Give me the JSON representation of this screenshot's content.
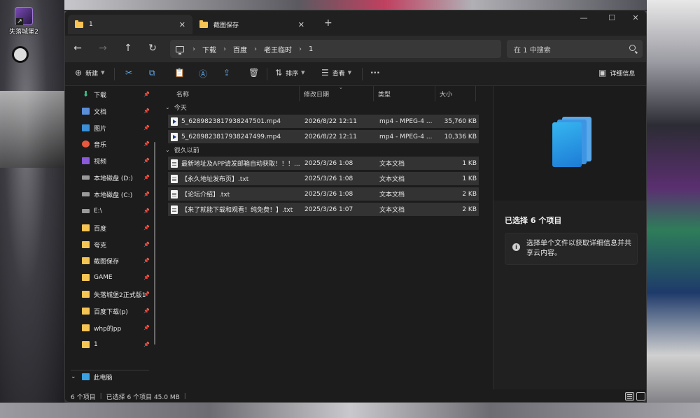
{
  "desktop": {
    "icon_label": "失落城堡2"
  },
  "tabs": [
    {
      "label": "1"
    },
    {
      "label": "截图保存"
    }
  ],
  "address": {
    "crumbs": [
      "下载",
      "百度",
      "老王临时",
      "1"
    ]
  },
  "search": {
    "placeholder": "在 1 中搜索"
  },
  "toolbar": {
    "new_label": "新建",
    "sort_label": "排序",
    "view_label": "查看",
    "details_label": "详细信息"
  },
  "sidebar": {
    "items": [
      {
        "label": "下载",
        "icon": "download-icon"
      },
      {
        "label": "文档",
        "icon": "document-icon"
      },
      {
        "label": "图片",
        "icon": "pictures-icon"
      },
      {
        "label": "音乐",
        "icon": "music-icon"
      },
      {
        "label": "视频",
        "icon": "video-icon"
      },
      {
        "label": "本地磁盘 (D:)",
        "icon": "drive-icon"
      },
      {
        "label": "本地磁盘 (C:)",
        "icon": "drive-icon"
      },
      {
        "label": "E:\\",
        "icon": "drive-icon"
      },
      {
        "label": "百度",
        "icon": "folder-icon"
      },
      {
        "label": "夸克",
        "icon": "folder-icon"
      },
      {
        "label": "截图保存",
        "icon": "folder-icon"
      },
      {
        "label": "GAME",
        "icon": "folder-icon"
      },
      {
        "label": "失落城堡2正式版1",
        "icon": "folder-icon"
      },
      {
        "label": "百度下载(p)",
        "icon": "folder-icon"
      },
      {
        "label": "whp的pp",
        "icon": "folder-icon"
      },
      {
        "label": "1",
        "icon": "folder-icon"
      }
    ],
    "this_pc": "此电脑"
  },
  "columns": {
    "name": "名称",
    "date": "修改日期",
    "type": "类型",
    "size": "大小"
  },
  "groups": [
    {
      "title": "今天",
      "rows": [
        {
          "name": "5_6289823817938247501.mp4",
          "date": "2026/8/22 12:11",
          "type": "mp4 - MPEG-4 ...",
          "size": "35,760 KB",
          "icon": "video-file-icon"
        },
        {
          "name": "5_6289823817938247499.mp4",
          "date": "2026/8/22 12:11",
          "type": "mp4 - MPEG-4 ...",
          "size": "10,336 KB",
          "icon": "video-file-icon"
        }
      ]
    },
    {
      "title": "很久以前",
      "rows": [
        {
          "name": "最新地址及APP请发邮箱自动获取！！！...",
          "date": "2025/3/26 1:08",
          "type": "文本文档",
          "size": "1 KB",
          "icon": "text-file-icon"
        },
        {
          "name": "【永久地址发布页】.txt",
          "date": "2025/3/26 1:08",
          "type": "文本文档",
          "size": "1 KB",
          "icon": "text-file-icon"
        },
        {
          "name": "【论坛介绍】.txt",
          "date": "2025/3/26 1:08",
          "type": "文本文档",
          "size": "2 KB",
          "icon": "text-file-icon"
        },
        {
          "name": "【来了就能下载和观看！纯免费！】.txt",
          "date": "2025/3/26 1:07",
          "type": "文本文档",
          "size": "2 KB",
          "icon": "text-file-icon"
        }
      ]
    }
  ],
  "details": {
    "title": "已选择 6 个项目",
    "info": "选择单个文件以获取详细信息并共享云内容。"
  },
  "status": {
    "count": "6 个项目",
    "selection": "已选择 6 个项目 45.0 MB"
  }
}
